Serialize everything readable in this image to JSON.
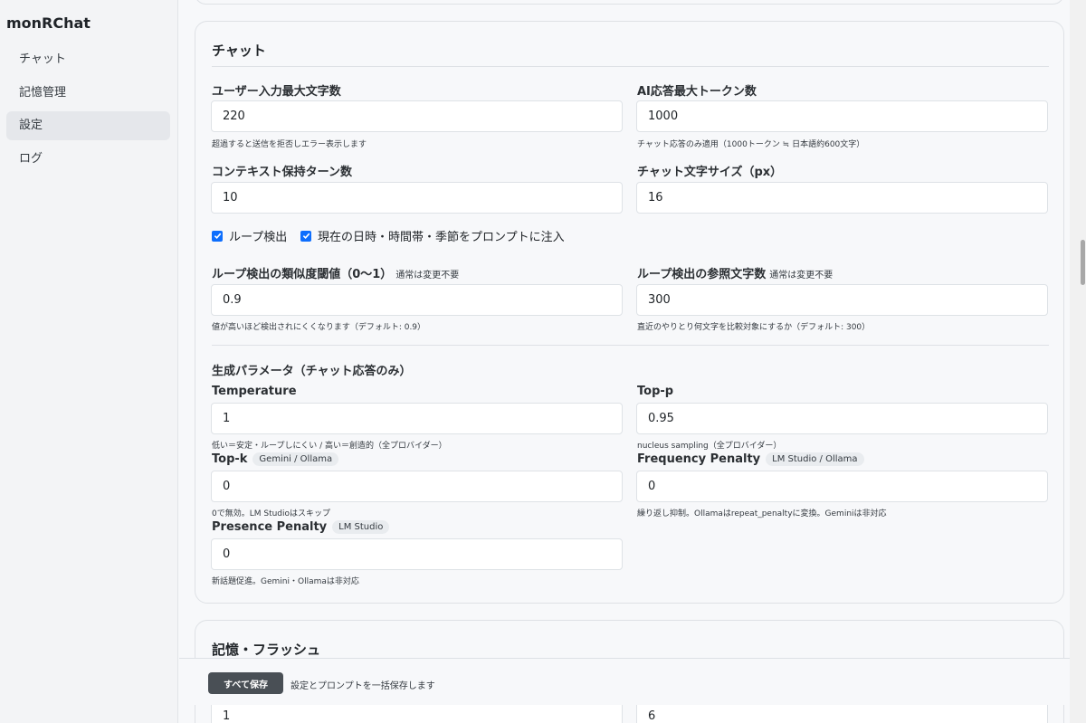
{
  "app": {
    "title": "monRChat"
  },
  "sidebar": {
    "items": [
      {
        "label": "チャット"
      },
      {
        "label": "記憶管理"
      },
      {
        "label": "設定"
      },
      {
        "label": "ログ"
      }
    ]
  },
  "chat_section": {
    "title": "チャット",
    "user_max_chars": {
      "label": "ユーザー入力最大文字数",
      "value": "220",
      "help": "超過すると送信を拒否しエラー表示します"
    },
    "ai_max_tokens": {
      "label": "AI応答最大トークン数",
      "value": "1000",
      "help": "チャット応答のみ適用（1000トークン ≒ 日本語約600文字）"
    },
    "context_turns": {
      "label": "コンテキスト保持ターン数",
      "value": "10"
    },
    "font_size": {
      "label": "チャット文字サイズ（px）",
      "value": "16"
    },
    "loop_detect": {
      "label": "ループ検出",
      "checked": true
    },
    "inject_datetime": {
      "label": "現在の日時・時間帯・季節をプロンプトに注入",
      "checked": true
    },
    "loop_threshold": {
      "label": "ループ検出の類似度閾値（0〜1）",
      "note": "通常は変更不要",
      "value": "0.9",
      "help": "値が高いほど検出されにくくなります（デフォルト: 0.9）"
    },
    "loop_ref_chars": {
      "label": "ループ検出の参照文字数",
      "note": "通常は変更不要",
      "value": "300",
      "help": "直近のやりとり何文字を比較対象にするか（デフォルト: 300）"
    }
  },
  "gen_params": {
    "title": "生成パラメータ（チャット応答のみ）",
    "temperature": {
      "label": "Temperature",
      "value": "1",
      "help": "低い＝安定・ループしにくい / 高い＝創造的（全プロバイダー）"
    },
    "top_p": {
      "label": "Top-p",
      "value": "0.95",
      "help": "nucleus sampling（全プロバイダー）"
    },
    "top_k": {
      "label": "Top-k",
      "badge": "Gemini / Ollama",
      "value": "0",
      "help": "0で無効。LM Studioはスキップ"
    },
    "frequency_penalty": {
      "label": "Frequency Penalty",
      "badge": "LM Studio / Ollama",
      "value": "0",
      "help": "繰り返し抑制。Ollamaはrepeat_penaltyに変換。Geminiは非対応"
    },
    "presence_penalty": {
      "label": "Presence Penalty",
      "badge": "LM Studio",
      "value": "0",
      "help": "新話題促進。Gemini・Ollamaは非対応"
    }
  },
  "memory_section": {
    "title": "記憶・フラッシュ",
    "field_left": {
      "value": "1"
    },
    "field_right": {
      "value": "6"
    }
  },
  "save_bar": {
    "button": "すべて保存",
    "hint": "設定とプロンプトを一括保存します"
  },
  "colors": {
    "accent": "#0d6efd",
    "save_button": "#494f55"
  }
}
